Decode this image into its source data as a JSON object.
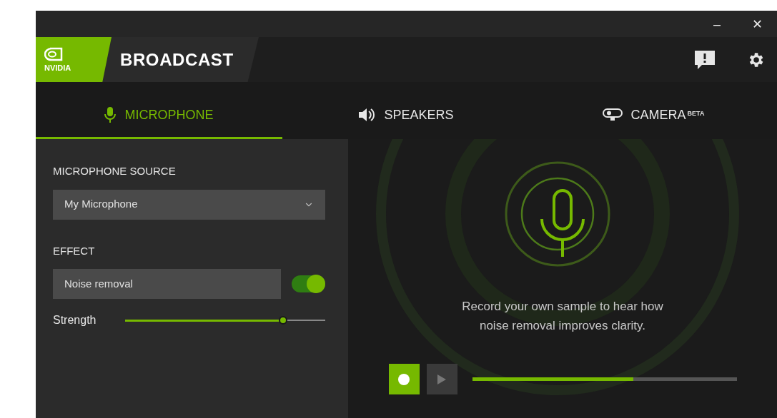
{
  "window": {
    "controls": [
      "–",
      "✕"
    ]
  },
  "header": {
    "logo_text": "NVIDIA",
    "app_name": "BROADCAST"
  },
  "tabs": [
    {
      "label": "MICROPHONE",
      "kind": "mic",
      "selected": true
    },
    {
      "label": "SPEAKERS",
      "kind": "speaker",
      "selected": false
    },
    {
      "label": "CAMERA",
      "superscript": "BETA",
      "kind": "camera",
      "selected": false
    }
  ],
  "source": {
    "heading": "MICROPHONE SOURCE",
    "value": "My Microphone"
  },
  "effect": {
    "heading": "EFFECT",
    "value": "Noise removal",
    "on": true
  },
  "strength": {
    "label": "Strength",
    "level": 0.79
  },
  "preview": {
    "message": "Record your own sample to hear how noise removal improves clarity.",
    "recording": true,
    "level": 0.61
  }
}
